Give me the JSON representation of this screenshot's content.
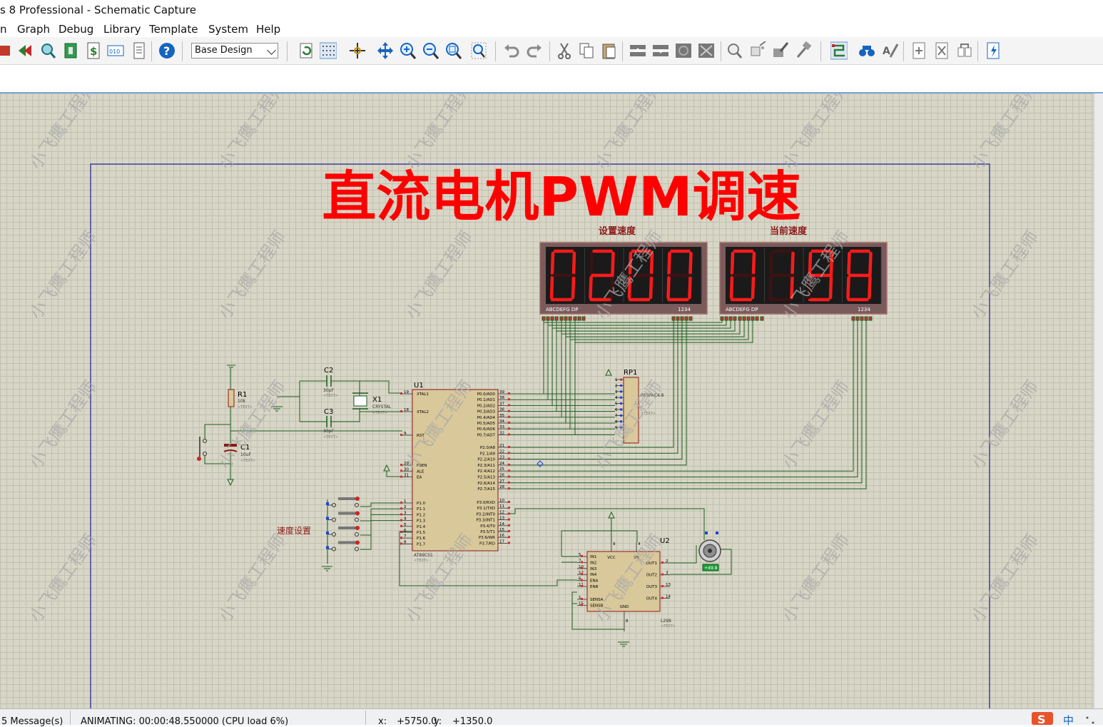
{
  "window": {
    "title": "s 8 Professional - Schematic Capture"
  },
  "menu": {
    "items": [
      "n",
      "Graph",
      "Debug",
      "Library",
      "Template",
      "System",
      "Help"
    ]
  },
  "toolbar": {
    "design_select": "Base Design"
  },
  "schematic": {
    "title": "直流电机PWM调速",
    "watermark": "小飞鹰工程师",
    "display_set": {
      "label": "设置速度",
      "digits": "0200",
      "pins_left": "ABCDEFG  DP",
      "pins_right": "1234"
    },
    "display_cur": {
      "label": "当前速度",
      "digits": "0198",
      "pins_left": "ABCDEFG  DP",
      "pins_right": "1234"
    },
    "speed_label": "速度设置",
    "components": {
      "u1": {
        "ref": "U1",
        "part": "AT89C51",
        "text": "<TEXT>"
      },
      "u2": {
        "ref": "U2",
        "part": "L298",
        "text": "<TEXT>"
      },
      "rp1": {
        "ref": "RP1",
        "part": "RESPACK-8",
        "text": "<TEXT>"
      },
      "r1": {
        "ref": "R1",
        "value": "10k",
        "text": "<TEXT>"
      },
      "c1": {
        "ref": "C1",
        "value": "10uF",
        "text": "<TEXT>"
      },
      "c2": {
        "ref": "C2",
        "value": "30pF",
        "text": "<TEXT>"
      },
      "c3": {
        "ref": "C3",
        "value": "30pF",
        "text": "<TEXT>"
      },
      "x1": {
        "ref": "X1",
        "part": "CRYSTAL",
        "text": "<TEXT>"
      },
      "motor": {
        "readout": "+49.8"
      }
    },
    "u1_pins": {
      "left_top": [
        [
          "19",
          "XTAL1"
        ],
        [
          "18",
          "XTAL2"
        ],
        [
          "9",
          "RST"
        ]
      ],
      "left_mid": [
        [
          "29",
          "PSEN"
        ],
        [
          "30",
          "ALE"
        ],
        [
          "31",
          "EA"
        ]
      ],
      "left_p1": [
        [
          "1",
          "P1.0"
        ],
        [
          "2",
          "P1.1"
        ],
        [
          "3",
          "P1.2"
        ],
        [
          "4",
          "P1.3"
        ],
        [
          "5",
          "P1.4"
        ],
        [
          "6",
          "P1.5"
        ],
        [
          "7",
          "P1.6"
        ],
        [
          "8",
          "P1.7"
        ]
      ],
      "right_p0": [
        [
          "39",
          "P0.0/AD0"
        ],
        [
          "38",
          "P0.1/AD1"
        ],
        [
          "37",
          "P0.2/AD2"
        ],
        [
          "36",
          "P0.3/AD3"
        ],
        [
          "35",
          "P0.4/AD4"
        ],
        [
          "34",
          "P0.5/AD5"
        ],
        [
          "33",
          "P0.6/AD6"
        ],
        [
          "32",
          "P0.7/AD7"
        ]
      ],
      "right_p2": [
        [
          "21",
          "P2.0/A8"
        ],
        [
          "22",
          "P2.1/A9"
        ],
        [
          "23",
          "P2.2/A10"
        ],
        [
          "24",
          "P2.3/A11"
        ],
        [
          "25",
          "P2.4/A12"
        ],
        [
          "26",
          "P2.5/A13"
        ],
        [
          "27",
          "P2.6/A14"
        ],
        [
          "28",
          "P2.7/A15"
        ]
      ],
      "right_p3": [
        [
          "10",
          "P3.0/RXD"
        ],
        [
          "11",
          "P3.1/TXD"
        ],
        [
          "12",
          "P3.2/INT0"
        ],
        [
          "13",
          "P3.3/INT1"
        ],
        [
          "14",
          "P3.4/T0"
        ],
        [
          "15",
          "P3.5/T1"
        ],
        [
          "16",
          "P3.6/WR"
        ],
        [
          "17",
          "P3.7/RD"
        ]
      ]
    },
    "u2_pins": {
      "left": [
        [
          "5",
          "IN1"
        ],
        [
          "7",
          "IN2"
        ],
        [
          "10",
          "IN3"
        ],
        [
          "12",
          "IN4"
        ],
        [
          "6",
          "ENA"
        ],
        [
          "11",
          "ENB"
        ]
      ],
      "sense": [
        [
          "1",
          "SENSA"
        ],
        [
          "15",
          "SENSB"
        ]
      ],
      "right": [
        [
          "2",
          "OUT1"
        ],
        [
          "3",
          "OUT2"
        ],
        [
          "13",
          "OUT3"
        ],
        [
          "14",
          "OUT4"
        ]
      ],
      "top": [
        [
          "9",
          "VCC"
        ],
        [
          "4",
          "VS"
        ]
      ],
      "bottom": [
        [
          "8",
          "GND"
        ]
      ]
    },
    "rp1_pins": [
      "1",
      "2",
      "3",
      "4",
      "5",
      "6",
      "7",
      "8",
      "9"
    ]
  },
  "status": {
    "messages": "5 Message(s)",
    "animating": "ANIMATING: 00:00:48.550000 (CPU load 6%)",
    "x_label": "x:",
    "x_value": "+5750.0",
    "y_label": "y:",
    "y_value": "+1350.0"
  }
}
